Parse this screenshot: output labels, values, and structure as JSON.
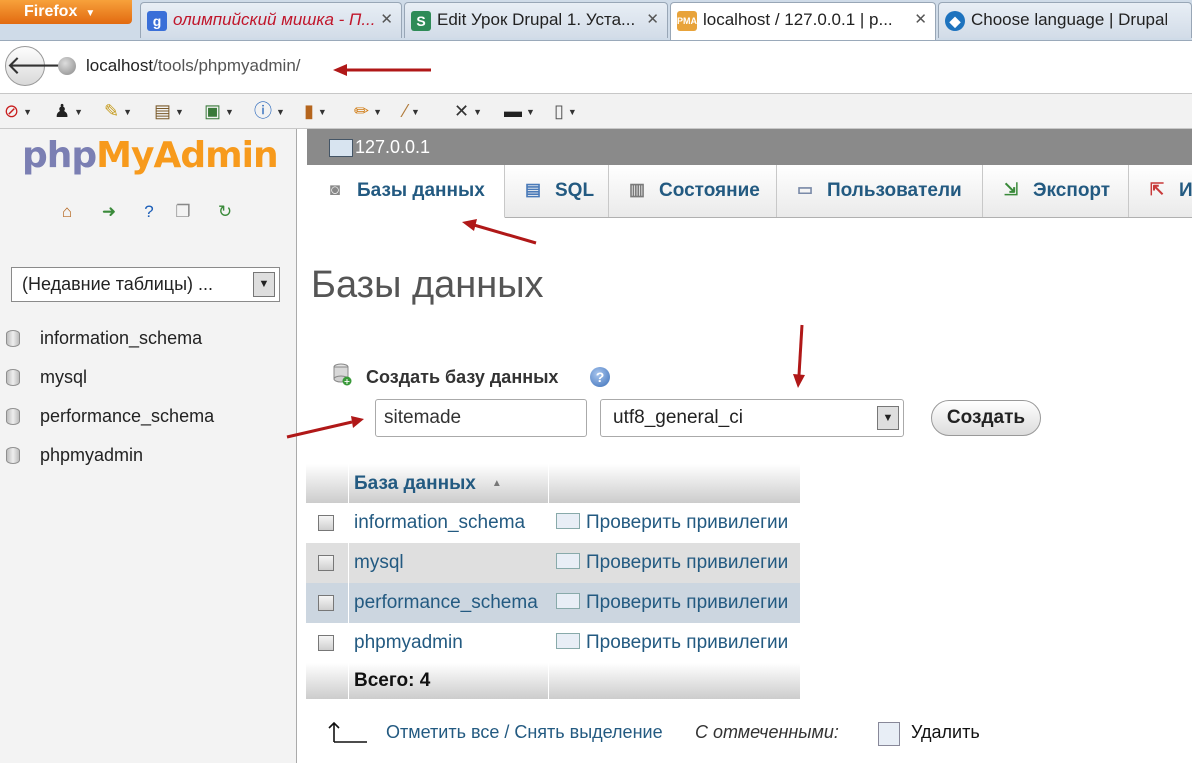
{
  "browser": {
    "firefox_label": "Firefox",
    "tabs": [
      {
        "label": "олимпийский мишка - П...",
        "icon": "google-icon"
      },
      {
        "label": "Edit Урок Drupal 1. Уста...",
        "icon": "sm-icon"
      },
      {
        "label": "localhost / 127.0.0.1 | p...",
        "icon": "pma-icon"
      },
      {
        "label": "Choose language | Drupal",
        "icon": "drupal-icon"
      }
    ],
    "close_glyph": "✕",
    "url_host": "localhost",
    "url_path": "/tools/phpmyadmin/"
  },
  "sidebar": {
    "logo_php": "php",
    "logo_myadmin": "MyAdmin",
    "recent_tables": "(Недавние таблицы) ...",
    "databases": [
      "information_schema",
      "mysql",
      "performance_schema",
      "phpmyadmin"
    ]
  },
  "server": {
    "label": "127.0.0.1"
  },
  "tabs": [
    {
      "label": "Базы данных"
    },
    {
      "label": "SQL"
    },
    {
      "label": "Состояние"
    },
    {
      "label": "Пользователи"
    },
    {
      "label": "Экспорт"
    },
    {
      "label": "И"
    }
  ],
  "page_title": "Базы данных",
  "create": {
    "heading": "Создать базу данных",
    "db_name_value": "sitemade",
    "collation_value": "utf8_general_ci",
    "button_label": "Создать"
  },
  "table": {
    "header": "База данных",
    "rows": [
      {
        "name": "information_schema",
        "action": "Проверить привилегии"
      },
      {
        "name": "mysql",
        "action": "Проверить привилегии"
      },
      {
        "name": "performance_schema",
        "action": "Проверить привилегии"
      },
      {
        "name": "phpmyadmin",
        "action": "Проверить привилегии"
      }
    ],
    "total": "Всего: 4"
  },
  "bottom": {
    "select_all": "Отметить все / Снять выделение",
    "with_selected": "С отмеченными:",
    "delete_label": "Удалить"
  },
  "colors": {
    "accent": "#235a81",
    "annotation": "#b01818"
  }
}
